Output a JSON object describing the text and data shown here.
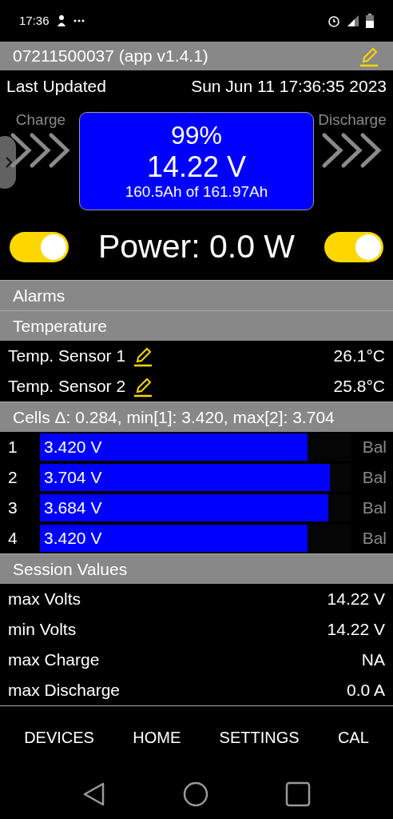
{
  "status_bar": {
    "time": "17:36"
  },
  "header": {
    "title": "07211500037 (app v1.4.1)"
  },
  "last_updated": {
    "label": "Last Updated",
    "value": "Sun Jun 11 17:36:35 2023"
  },
  "battery": {
    "charge_label": "Charge",
    "discharge_label": "Discharge",
    "percent": "99%",
    "voltage": "14.22 V",
    "capacity": "160.5Ah of 161.97Ah"
  },
  "power": {
    "text": "Power: 0.0 W",
    "charge_switch_on": true,
    "discharge_switch_on": true
  },
  "sections": [
    {
      "title": "Alarms"
    },
    {
      "title": "Temperature"
    }
  ],
  "sensors": [
    {
      "name": "Temp. Sensor 1",
      "value": "26.1°C"
    },
    {
      "name": "Temp. Sensor 2",
      "value": "25.8°C"
    }
  ],
  "cells_header": "Cells Δ: 0.284, min[1]: 3.420, max[2]: 3.704",
  "cells": [
    {
      "index": "1",
      "voltage": "3.420 V",
      "level": 0.86,
      "balance": "Bal"
    },
    {
      "index": "2",
      "voltage": "3.704 V",
      "level": 0.93,
      "balance": "Bal"
    },
    {
      "index": "3",
      "voltage": "3.684 V",
      "level": 0.925,
      "balance": "Bal"
    },
    {
      "index": "4",
      "voltage": "3.420 V",
      "level": 0.86,
      "balance": "Bal"
    }
  ],
  "session": {
    "title": "Session Values",
    "rows": [
      {
        "label": "max Volts",
        "value": "14.22 V"
      },
      {
        "label": "min Volts",
        "value": "14.22 V"
      },
      {
        "label": "max Charge",
        "value": "NA"
      },
      {
        "label": "max Discharge",
        "value": "0.0 A"
      }
    ]
  },
  "bottom_nav": [
    "DEVICES",
    "HOME",
    "SETTINGS",
    "CAL"
  ]
}
